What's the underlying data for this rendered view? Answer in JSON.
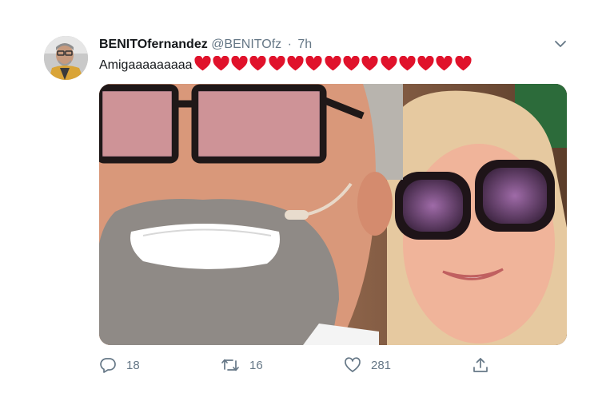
{
  "tweet": {
    "display_name": "BENITOfernandez",
    "handle": "@BENITOfz",
    "separator": "·",
    "time": "7h",
    "text": "Amigaaaaaaaaa",
    "heart_emoji_count": 15,
    "heart_color": "#e0122b"
  },
  "actions": {
    "reply_count": "18",
    "retweet_count": "16",
    "like_count": "281"
  },
  "icons": {
    "caret": "chevron-down-icon",
    "reply": "reply-icon",
    "retweet": "retweet-icon",
    "like": "heart-icon",
    "share": "share-icon"
  },
  "colors": {
    "text_primary": "#14171a",
    "text_secondary": "#657786",
    "background": "#ffffff"
  }
}
